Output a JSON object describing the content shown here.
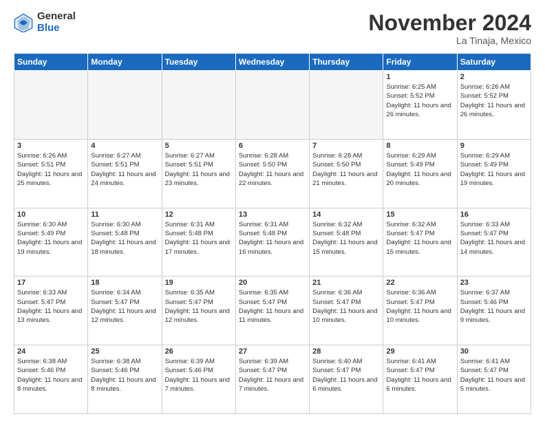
{
  "logo": {
    "general": "General",
    "blue": "Blue"
  },
  "title": "November 2024",
  "location": "La Tinaja, Mexico",
  "days_header": [
    "Sunday",
    "Monday",
    "Tuesday",
    "Wednesday",
    "Thursday",
    "Friday",
    "Saturday"
  ],
  "weeks": [
    [
      {
        "day": "",
        "info": ""
      },
      {
        "day": "",
        "info": ""
      },
      {
        "day": "",
        "info": ""
      },
      {
        "day": "",
        "info": ""
      },
      {
        "day": "",
        "info": ""
      },
      {
        "day": "1",
        "info": "Sunrise: 6:25 AM\nSunset: 5:52 PM\nDaylight: 11 hours and 26 minutes."
      },
      {
        "day": "2",
        "info": "Sunrise: 6:26 AM\nSunset: 5:52 PM\nDaylight: 11 hours and 26 minutes."
      }
    ],
    [
      {
        "day": "3",
        "info": "Sunrise: 6:26 AM\nSunset: 5:51 PM\nDaylight: 11 hours and 25 minutes."
      },
      {
        "day": "4",
        "info": "Sunrise: 6:27 AM\nSunset: 5:51 PM\nDaylight: 11 hours and 24 minutes."
      },
      {
        "day": "5",
        "info": "Sunrise: 6:27 AM\nSunset: 5:51 PM\nDaylight: 11 hours and 23 minutes."
      },
      {
        "day": "6",
        "info": "Sunrise: 6:28 AM\nSunset: 5:50 PM\nDaylight: 11 hours and 22 minutes."
      },
      {
        "day": "7",
        "info": "Sunrise: 6:28 AM\nSunset: 5:50 PM\nDaylight: 11 hours and 21 minutes."
      },
      {
        "day": "8",
        "info": "Sunrise: 6:29 AM\nSunset: 5:49 PM\nDaylight: 11 hours and 20 minutes."
      },
      {
        "day": "9",
        "info": "Sunrise: 6:29 AM\nSunset: 5:49 PM\nDaylight: 11 hours and 19 minutes."
      }
    ],
    [
      {
        "day": "10",
        "info": "Sunrise: 6:30 AM\nSunset: 5:49 PM\nDaylight: 11 hours and 19 minutes."
      },
      {
        "day": "11",
        "info": "Sunrise: 6:30 AM\nSunset: 5:48 PM\nDaylight: 11 hours and 18 minutes."
      },
      {
        "day": "12",
        "info": "Sunrise: 6:31 AM\nSunset: 5:48 PM\nDaylight: 11 hours and 17 minutes."
      },
      {
        "day": "13",
        "info": "Sunrise: 6:31 AM\nSunset: 5:48 PM\nDaylight: 11 hours and 16 minutes."
      },
      {
        "day": "14",
        "info": "Sunrise: 6:32 AM\nSunset: 5:48 PM\nDaylight: 11 hours and 15 minutes."
      },
      {
        "day": "15",
        "info": "Sunrise: 6:32 AM\nSunset: 5:47 PM\nDaylight: 11 hours and 15 minutes."
      },
      {
        "day": "16",
        "info": "Sunrise: 6:33 AM\nSunset: 5:47 PM\nDaylight: 11 hours and 14 minutes."
      }
    ],
    [
      {
        "day": "17",
        "info": "Sunrise: 6:33 AM\nSunset: 5:47 PM\nDaylight: 11 hours and 13 minutes."
      },
      {
        "day": "18",
        "info": "Sunrise: 6:34 AM\nSunset: 5:47 PM\nDaylight: 11 hours and 12 minutes."
      },
      {
        "day": "19",
        "info": "Sunrise: 6:35 AM\nSunset: 5:47 PM\nDaylight: 11 hours and 12 minutes."
      },
      {
        "day": "20",
        "info": "Sunrise: 6:35 AM\nSunset: 5:47 PM\nDaylight: 11 hours and 11 minutes."
      },
      {
        "day": "21",
        "info": "Sunrise: 6:36 AM\nSunset: 5:47 PM\nDaylight: 11 hours and 10 minutes."
      },
      {
        "day": "22",
        "info": "Sunrise: 6:36 AM\nSunset: 5:47 PM\nDaylight: 11 hours and 10 minutes."
      },
      {
        "day": "23",
        "info": "Sunrise: 6:37 AM\nSunset: 5:46 PM\nDaylight: 11 hours and 9 minutes."
      }
    ],
    [
      {
        "day": "24",
        "info": "Sunrise: 6:38 AM\nSunset: 5:46 PM\nDaylight: 11 hours and 8 minutes."
      },
      {
        "day": "25",
        "info": "Sunrise: 6:38 AM\nSunset: 5:46 PM\nDaylight: 11 hours and 8 minutes."
      },
      {
        "day": "26",
        "info": "Sunrise: 6:39 AM\nSunset: 5:46 PM\nDaylight: 11 hours and 7 minutes."
      },
      {
        "day": "27",
        "info": "Sunrise: 6:39 AM\nSunset: 5:47 PM\nDaylight: 11 hours and 7 minutes."
      },
      {
        "day": "28",
        "info": "Sunrise: 6:40 AM\nSunset: 5:47 PM\nDaylight: 11 hours and 6 minutes."
      },
      {
        "day": "29",
        "info": "Sunrise: 6:41 AM\nSunset: 5:47 PM\nDaylight: 11 hours and 6 minutes."
      },
      {
        "day": "30",
        "info": "Sunrise: 6:41 AM\nSunset: 5:47 PM\nDaylight: 11 hours and 5 minutes."
      }
    ]
  ]
}
